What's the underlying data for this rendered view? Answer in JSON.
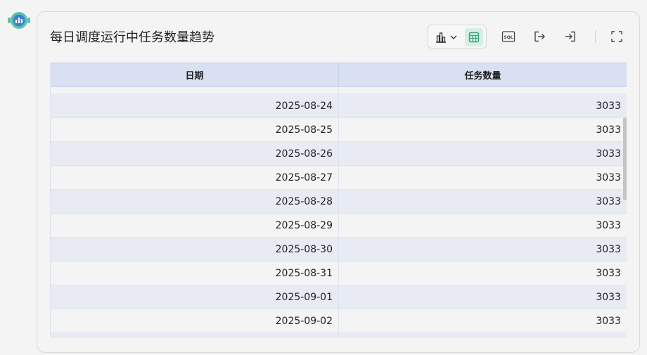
{
  "card": {
    "title": "每日调度运行中任务数量趋势"
  },
  "toolbar": {
    "chart_icon": "bar-chart-icon",
    "table_icon": "table-icon",
    "sql_label": "SQL",
    "accent_color": "#3aa57a"
  },
  "table": {
    "columns": [
      "日期",
      "任务数量"
    ],
    "rows": [
      {
        "date": "2025-08-24",
        "count": "3033"
      },
      {
        "date": "2025-08-25",
        "count": "3033"
      },
      {
        "date": "2025-08-26",
        "count": "3033"
      },
      {
        "date": "2025-08-27",
        "count": "3033"
      },
      {
        "date": "2025-08-28",
        "count": "3033"
      },
      {
        "date": "2025-08-29",
        "count": "3033"
      },
      {
        "date": "2025-08-30",
        "count": "3033"
      },
      {
        "date": "2025-08-31",
        "count": "3033"
      },
      {
        "date": "2025-09-01",
        "count": "3033"
      },
      {
        "date": "2025-09-02",
        "count": "3033"
      }
    ]
  }
}
